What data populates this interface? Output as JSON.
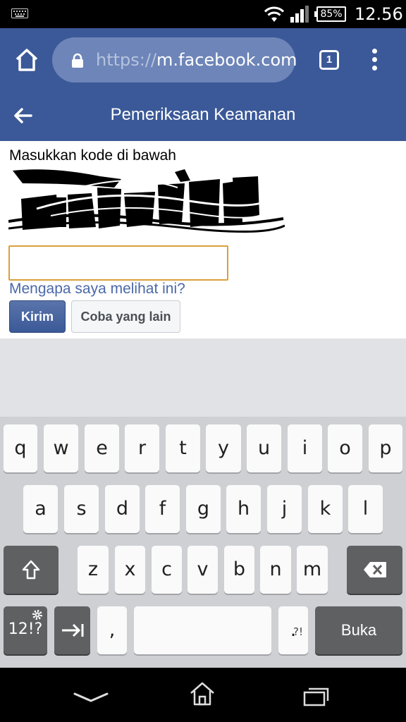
{
  "status_bar": {
    "battery": "85%",
    "time": "12.56"
  },
  "browser": {
    "url_scheme": "https://",
    "url_host": "m.facebook.com",
    "tab_count": "1"
  },
  "header": {
    "title": "Pemeriksaan Keamanan"
  },
  "form": {
    "instruction": "Masukkan kode di bawah",
    "input_value": "",
    "why_link": "Mengapa saya melihat ini?",
    "submit_label": "Kirim",
    "other_label": "Coba yang lain"
  },
  "keyboard": {
    "row1": [
      "q",
      "w",
      "e",
      "r",
      "t",
      "y",
      "u",
      "i",
      "o",
      "p"
    ],
    "row2": [
      "a",
      "s",
      "d",
      "f",
      "g",
      "h",
      "j",
      "k",
      "l"
    ],
    "row3": [
      "z",
      "x",
      "c",
      "v",
      "b",
      "n",
      "m"
    ],
    "symbols_label": "12!?",
    "comma": ",",
    "period": ".",
    "period_alt": "?!",
    "enter_label": "Buka"
  },
  "colors": {
    "facebook_blue": "#3b5998",
    "link_blue": "#4a68a9",
    "input_border": "#d9a03a"
  }
}
